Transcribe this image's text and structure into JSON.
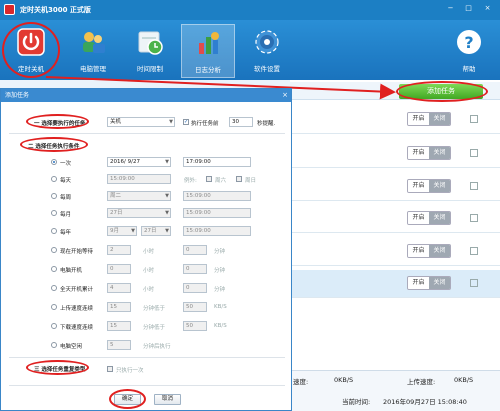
{
  "window": {
    "title": "定时关机3000 正式版",
    "controls": [
      "−",
      "□",
      "×"
    ]
  },
  "toolbar": {
    "items": [
      {
        "label": "定时关机",
        "icon": "power-icon"
      },
      {
        "label": "电脑管理",
        "icon": "computer-manage-icon"
      },
      {
        "label": "时间限制",
        "icon": "clock-icon"
      },
      {
        "label": "日志分析",
        "icon": "chart-log-icon"
      },
      {
        "label": "软件设置",
        "icon": "gear-icon"
      },
      {
        "label": "帮助",
        "icon": "help-icon"
      }
    ]
  },
  "main": {
    "add_task_label": "添加任务",
    "toggle_on": "开启",
    "toggle_off": "关闭",
    "status": {
      "speed_label": "速度:",
      "download_value": "0KB/S",
      "upload_label": "上传速度:",
      "upload_value": "0KB/S",
      "current_time_label": "当前时间:",
      "current_time_value": "2016年09月27日 15:08:40"
    }
  },
  "dialog": {
    "title": "添加任务",
    "close": "×",
    "section1_label": "一 选择要执行的任务",
    "task_select": "关机",
    "run_task_before_label": "执行任务前",
    "run_before_seconds": "30",
    "seconds_hint_label": "秒提醒.",
    "section2_label": "二 选择任务执行条件",
    "once_label": "一次",
    "once_date": "2016/ 9/27",
    "once_time": "17:09:00",
    "daily_label": "每天",
    "daily_time": "15:09:00",
    "daily_exclude_label": "例外:",
    "daily_weekend_label": "周六",
    "daily_sunday_label": "周日",
    "weekly_label": "每周",
    "weekly_day": "周二",
    "weekly_time": "15:09:00",
    "monthly_label": "每月",
    "monthly_day": "27日",
    "monthly_time": "15:09:00",
    "yearly_label": "每年",
    "yearly_month": "9月",
    "yearly_day": "27日",
    "yearly_time": "15:09:00",
    "wait_label": "现在开始等待",
    "wait_hours": "2",
    "wait_mins": "0",
    "boot_label": "电脑开机",
    "boot_hours": "0",
    "boot_mins": "0",
    "cumulative_label": "全天开机累计",
    "cumulative_hours": "4",
    "cumulative_mins": "0",
    "upload_cont_label": "上传速度连续",
    "upload_mins": "15",
    "download_cont_label": "下载速度连续",
    "download_mins": "15",
    "idle_label": "电脑空闲",
    "idle_mins": "5",
    "hours_unit": "小时",
    "minutes_unit": "分钟",
    "minutes_below_label": "分钟低于",
    "kbs_unit": "KB/S",
    "idle_after_label": "分钟后执行",
    "upload_threshold": "50",
    "download_threshold": "50",
    "section3_label": "三 选择任务重复类型",
    "repeat_option_label": "只执行一次",
    "ok_label": "确定",
    "cancel_label": "取消"
  },
  "colors": {
    "title_blue": "#1c7fc4",
    "accent_green": "#41a823",
    "annotation_red": "#e02020"
  }
}
